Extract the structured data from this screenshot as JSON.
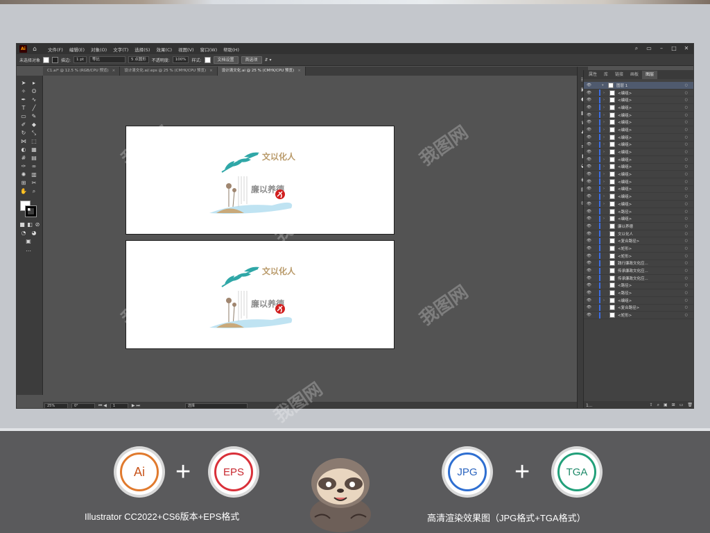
{
  "menubar": {
    "logo": "Ai",
    "items": [
      "文件(F)",
      "编辑(E)",
      "对象(O)",
      "文字(T)",
      "选择(S)",
      "效果(C)",
      "视图(V)",
      "窗口(W)",
      "帮助(H)"
    ]
  },
  "controlbar": {
    "selection": "未选择对象",
    "stroke_label": "描边:",
    "stroke_value": "1 pt",
    "uniform": "等比",
    "brush": "5 点圆形",
    "opacity_label": "不透明度:",
    "opacity_value": "100%",
    "style_label": "样式:",
    "doc_settings": "文档设置",
    "preferences": "首选项"
  },
  "tabs": [
    {
      "label": "C1.ai* @ 12.5 % (RGB/CPU 预览)",
      "active": false
    },
    {
      "label": "设计清文化.ai/.eps @ 25 % (CMYK/CPU 预览)",
      "active": false
    },
    {
      "label": "设计清文化.ai @ 25 % (CMYK/CPU 预览)",
      "active": true
    }
  ],
  "artwork": {
    "title_top": "文以化人",
    "title_bottom": "廉以养德",
    "colors": {
      "gold": "#b99a6a",
      "gray": "#8c8c8c",
      "teal": "#2fa7a7",
      "red": "#d11f1f",
      "water": "#bfe3f2"
    }
  },
  "statusbar": {
    "zoom": "25%",
    "rotate": "0°",
    "page": "1",
    "tool": "选择"
  },
  "panel": {
    "tabs": [
      "属性",
      "库",
      "链接",
      "画板",
      "图层"
    ],
    "active_tab": "图层",
    "top_layer": "图层 1",
    "layers": [
      {
        "name": "<编组>",
        "expand": true
      },
      {
        "name": "<编组>",
        "expand": true
      },
      {
        "name": "<编组>",
        "expand": true
      },
      {
        "name": "<编组>",
        "expand": true
      },
      {
        "name": "<编组>",
        "expand": true
      },
      {
        "name": "<编组>",
        "expand": true
      },
      {
        "name": "<编组>",
        "expand": true
      },
      {
        "name": "<编组>",
        "expand": true
      },
      {
        "name": "<编组>",
        "expand": true
      },
      {
        "name": "<编组>",
        "expand": true
      },
      {
        "name": "<编组>",
        "expand": true
      },
      {
        "name": "<编组>",
        "expand": true
      },
      {
        "name": "<编组>",
        "expand": true
      },
      {
        "name": "<编组>",
        "expand": true
      },
      {
        "name": "<编组>",
        "expand": true
      },
      {
        "name": "<编组>",
        "expand": true
      },
      {
        "name": "<路径>",
        "expand": false
      },
      {
        "name": "<编组>",
        "expand": true
      },
      {
        "name": "廉以养德",
        "expand": false
      },
      {
        "name": "文以化人",
        "expand": false
      },
      {
        "name": "<复合路径>",
        "expand": false
      },
      {
        "name": "<矩形>",
        "expand": false
      },
      {
        "name": "<矩形>",
        "expand": false
      },
      {
        "name": "践行廉政文化应...",
        "expand": false
      },
      {
        "name": "传承廉政文化应...",
        "expand": false
      },
      {
        "name": "传承廉政文化应...",
        "expand": false
      },
      {
        "name": "<路径>",
        "expand": false
      },
      {
        "name": "<路径>",
        "expand": false
      },
      {
        "name": "<编组>",
        "expand": true
      },
      {
        "name": "<复合路径>",
        "expand": false
      },
      {
        "name": "<矩形>",
        "expand": false
      }
    ],
    "footer": "1..."
  },
  "promo": {
    "badges": [
      "Ai",
      "EPS",
      "JPG",
      "TGA"
    ],
    "plus": "+",
    "caption_left": "Illustrator CC2022+CS6版本+EPS格式",
    "caption_right": "高清渲染效果图（JPG格式+TGA格式）",
    "colors": {
      "ai": "#e07a2e",
      "eps": "#d9313a",
      "jpg": "#2f6fd1",
      "tga": "#22a07a"
    }
  },
  "watermark": "我图网"
}
